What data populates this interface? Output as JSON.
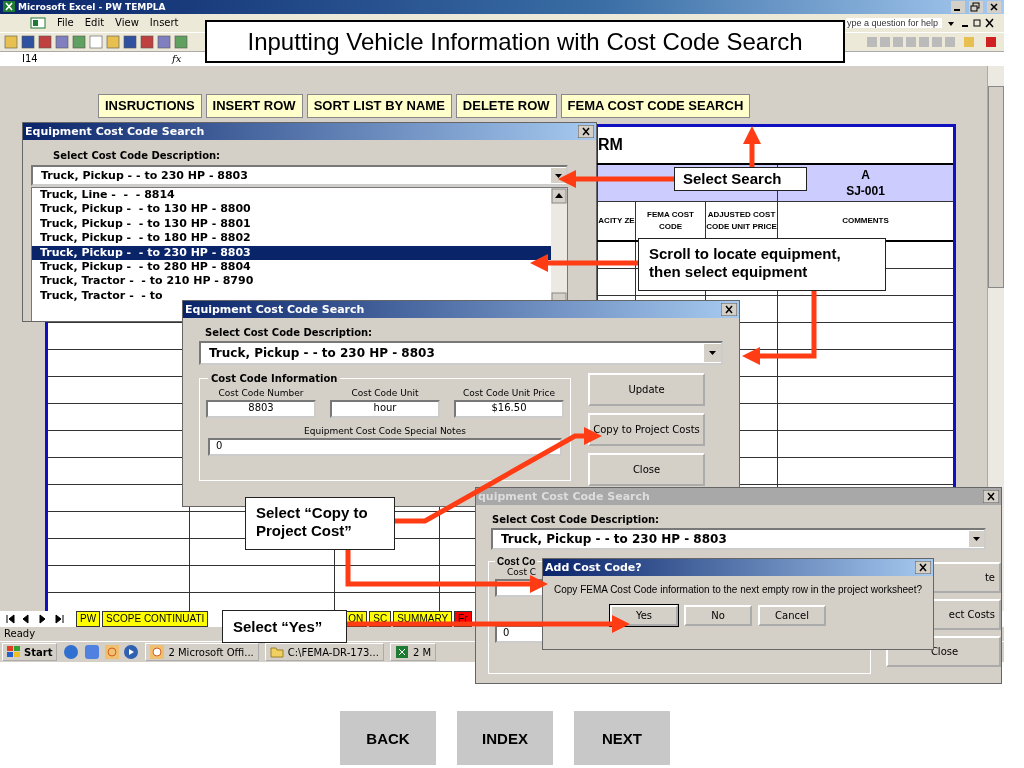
{
  "slide_title": "Inputting Vehicle Information with Cost Code Search",
  "excel": {
    "title": "Microsoft Excel - PW TEMPLA",
    "menu": [
      "File",
      "Edit",
      "View",
      "Insert"
    ],
    "help_box": "ype a question for help",
    "name_box": "I14",
    "formula_label": "fx",
    "sheet_buttons": [
      "INSRUCTIONS",
      "INSERT ROW",
      "SORT LIST BY NAME",
      "DELETE ROW",
      "FEMA COST CODE SEARCH"
    ],
    "sheet": {
      "form_title": "RM",
      "column_letter": "A",
      "column_code": "SJ-001",
      "headers": [
        "ACITY ZE",
        "FEMA COST CODE",
        "ADJUSTED COST CODE UNIT PRICE",
        "COMMENTS"
      ]
    },
    "sheet_tabs": [
      {
        "label": "PW",
        "color": "#ffff00"
      },
      {
        "label": "SCOPE CONTINUATI",
        "color": "#ffff00"
      },
      {
        "label": "ON",
        "color": "#ffff00"
      },
      {
        "label": "SC",
        "color": "#ffff00"
      },
      {
        "label": "SUMMARY",
        "color": "#ffff00"
      },
      {
        "label": "Fr",
        "color": "#ff0000"
      }
    ],
    "status": "Ready",
    "taskbar": {
      "start": "Start",
      "items": [
        {
          "kind": "clock",
          "label": "2 Microsoft Offi..."
        },
        {
          "kind": "folder",
          "label": "C:\\FEMA-DR-173..."
        },
        {
          "kind": "sheet",
          "label": "2 M"
        }
      ]
    }
  },
  "list_dialog": {
    "title": "Equipment Cost Code Search",
    "active": true,
    "label": "Select Cost Code Description:",
    "value": "Truck, Pickup -  - to 230 HP - 8803",
    "options": [
      {
        "label": "Truck, Line -  -  - 8814",
        "selected": false
      },
      {
        "label": "Truck, Pickup -  - to 130 HP - 8800",
        "selected": false
      },
      {
        "label": "Truck, Pickup -  - to 130 HP - 8801",
        "selected": false
      },
      {
        "label": "Truck, Pickup -  - to 180 HP - 8802",
        "selected": false
      },
      {
        "label": "Truck, Pickup -  - to 230 HP - 8803",
        "selected": true
      },
      {
        "label": "Truck, Pickup -  - to 280 HP - 8804",
        "selected": false
      },
      {
        "label": "Truck, Tractor -  - to 210 HP - 8790",
        "selected": false
      },
      {
        "label": "Truck, Tractor -  - to",
        "selected": false
      }
    ]
  },
  "info_dialog": {
    "title": "Equipment Cost Code Search",
    "active": true,
    "label": "Select Cost Code Description:",
    "value": "Truck, Pickup -  - to 230 HP - 8803",
    "group": "Cost Code Information",
    "fields": [
      {
        "label": "Cost Code Number",
        "value": "8803"
      },
      {
        "label": "Cost Code Unit",
        "value": "hour"
      },
      {
        "label": "Cost Code Unit Price",
        "value": "$16.50"
      }
    ],
    "notes_label": "Equipment Cost Code Special Notes",
    "notes_value": "0",
    "buttons": [
      "Update",
      "Copy to Project Costs",
      "Close"
    ]
  },
  "back_dialog": {
    "title": "quipment Cost Code Search",
    "active": false,
    "label": "Select Cost Code Description:",
    "value": "Truck, Pickup -  - to 230 HP - 8803",
    "group": "Cost Co",
    "field_label": "Cost C",
    "notes_value": "0",
    "buttons": [
      "te",
      "ect Costs",
      "Close"
    ]
  },
  "confirm": {
    "title": "Add Cost Code?",
    "active": true,
    "message": "Copy FEMA Cost Code information to the next empty row in the project worksheet?",
    "buttons": [
      {
        "label": "Yes",
        "default": true
      },
      {
        "label": "No",
        "default": false
      },
      {
        "label": "Cancel",
        "default": false
      }
    ]
  },
  "callouts": [
    "Select Search",
    "Scroll to locate equipment, then select equipment",
    "Select “Copy to Project Cost”",
    "Select “Yes”"
  ],
  "nav": [
    "BACK",
    "INDEX",
    "NEXT"
  ]
}
